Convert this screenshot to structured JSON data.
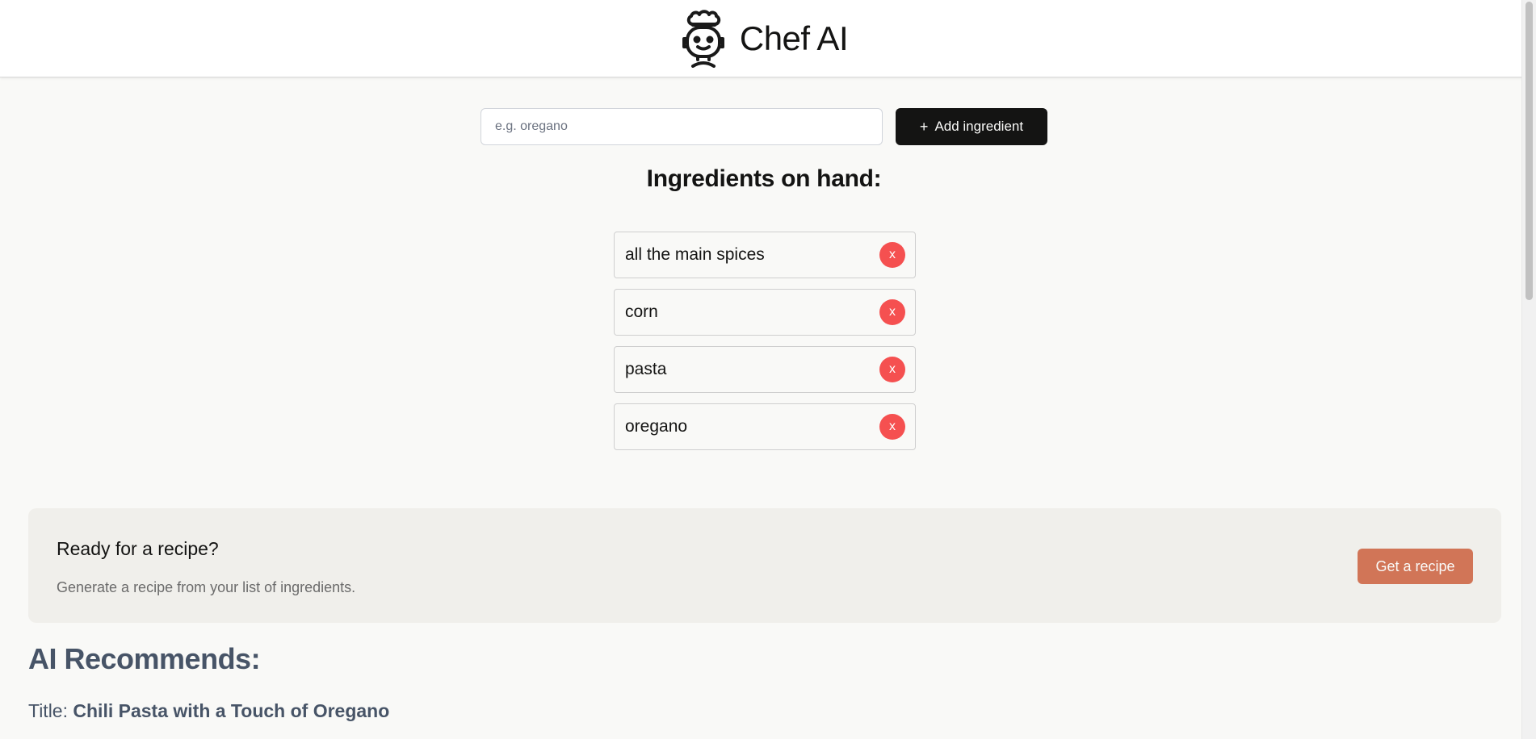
{
  "header": {
    "title": "Chef AI",
    "logo_icon": "chef-robot-icon"
  },
  "add_form": {
    "placeholder": "e.g. oregano",
    "value": "",
    "button_label": "Add ingredient",
    "button_icon": "+"
  },
  "ingredients": {
    "heading": "Ingredients on hand:",
    "items": [
      {
        "name": "all the main spices",
        "remove_label": "x"
      },
      {
        "name": "corn",
        "remove_label": "x"
      },
      {
        "name": "pasta",
        "remove_label": "x"
      },
      {
        "name": "oregano",
        "remove_label": "x"
      }
    ]
  },
  "recipe_panel": {
    "title": "Ready for a recipe?",
    "description": "Generate a recipe from your list of ingredients.",
    "button_label": "Get a recipe"
  },
  "recommendation": {
    "heading": "AI Recommends:",
    "title_prefix": "Title:",
    "title_value": "Chili Pasta with a Touch of Oregano"
  },
  "colors": {
    "page_background": "#f9f9f7",
    "primary_button": "#141413",
    "accent_button": "#d17557",
    "remove_button": "#f55050",
    "recommend_text": "#475467"
  }
}
